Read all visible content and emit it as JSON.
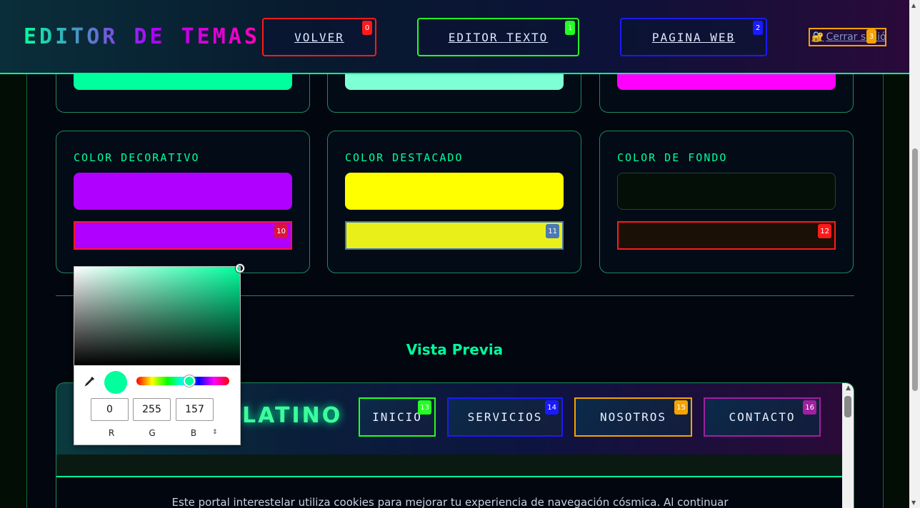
{
  "header": {
    "brand_part1": "EDITOR ",
    "brand_part2": "DE TEMAS",
    "buttons": [
      {
        "label": "VOLVER",
        "badge": "0",
        "color": "#ff1a1a"
      },
      {
        "label": "EDITOR TEXTO",
        "badge": "1",
        "color": "#22ff22"
      },
      {
        "label": "PAGINA WEB",
        "badge": "2",
        "color": "#1a1aff"
      }
    ],
    "logout": {
      "icon": "lock-key-icon",
      "label": "Cerrar sesión",
      "badge": "3",
      "color": "#f5a300"
    }
  },
  "top_swatches": [
    {
      "color": "#00ff9d"
    },
    {
      "color": "#7fffd4"
    },
    {
      "color": "#ff00ff"
    }
  ],
  "colors": [
    {
      "title": "Color decorativo",
      "swatch": "#b000ff",
      "input_bg": "#b000ff",
      "input_border": "#ff1a1a",
      "badge": "10",
      "badge_color": "#dc143c"
    },
    {
      "title": "Color destacado",
      "swatch": "#ffff00",
      "input_bg": "#e9f019",
      "input_border": "#4a7ab0",
      "badge": "11",
      "badge_color": "#4a7ab0"
    },
    {
      "title": "Color de fondo",
      "swatch": "#041007",
      "input_bg": "#1a1005",
      "input_border": "#ff1a1a",
      "badge": "12",
      "badge_color": "#ff1a1a"
    }
  ],
  "preview": {
    "title": "Vista Previa",
    "logo": "LATINO",
    "nav": [
      {
        "label": "INICIO",
        "badge": "13",
        "color": "#22ff22"
      },
      {
        "label": "SERVICIOS",
        "badge": "14",
        "color": "#1a1aff"
      },
      {
        "label": "NOSOTROS",
        "badge": "15",
        "color": "#f5a300"
      },
      {
        "label": "CONTACTO",
        "badge": "16",
        "color": "#a020a0"
      }
    ],
    "cookie_text": "Este portal interestelar utiliza cookies para mejorar tu experiencia de navegación cósmica. Al continuar"
  },
  "picker": {
    "r": "0",
    "g": "255",
    "b": "157",
    "r_label": "R",
    "g_label": "G",
    "b_label": "B",
    "current_color": "#00ff9d"
  }
}
